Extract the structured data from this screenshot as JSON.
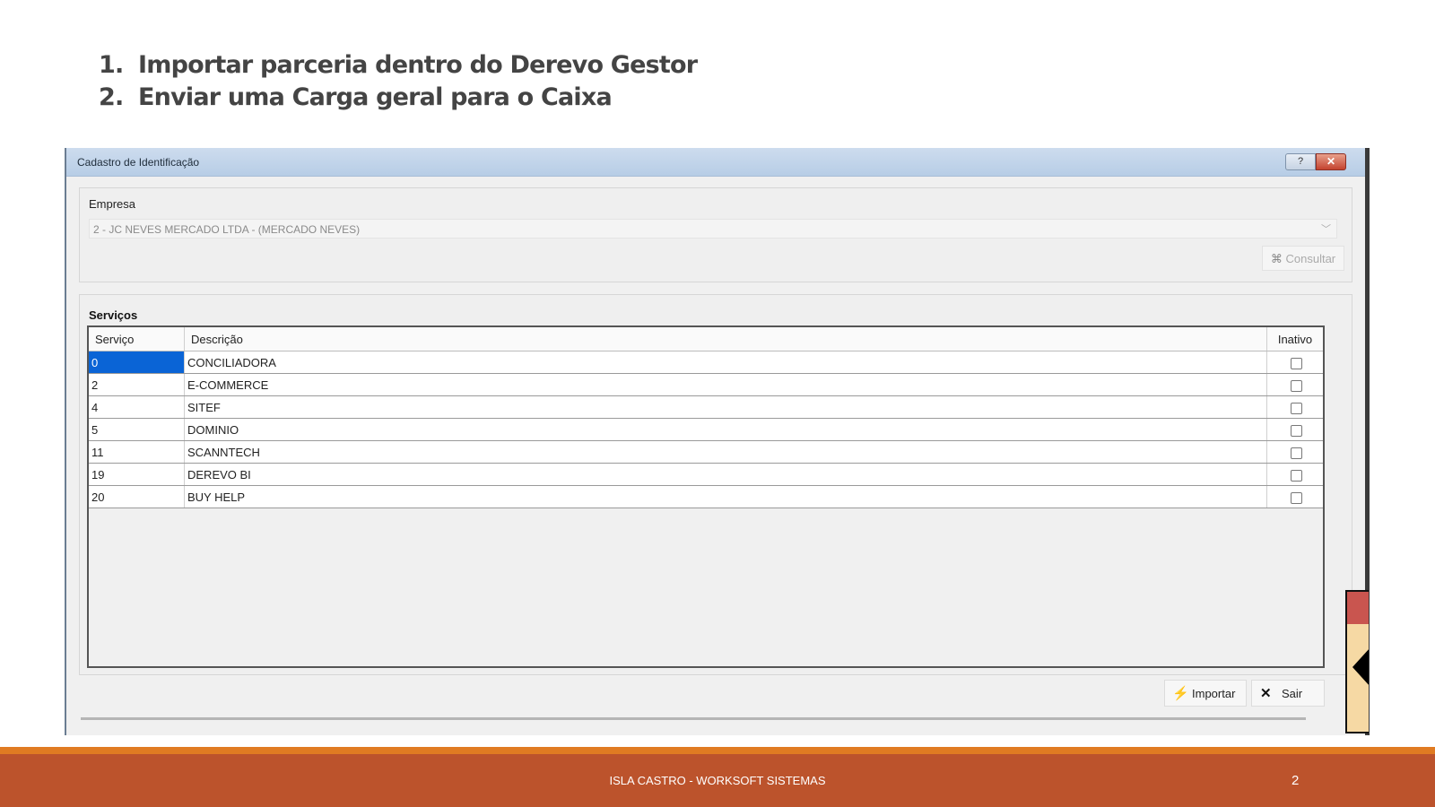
{
  "slide": {
    "steps": [
      {
        "num": "1.",
        "text": "Importar parceria dentro do Derevo Gestor"
      },
      {
        "num": "2.",
        "text": "Enviar uma Carga geral para o Caixa"
      }
    ],
    "footer_text": "ISLA CASTRO - WORKSOFT SISTEMAS",
    "page_number": "2"
  },
  "window": {
    "title": "Cadastro de Identificação",
    "help_glyph": "?",
    "close_glyph": "✕",
    "empresa_label": "Empresa",
    "empresa_value": "2 - JC NEVES MERCADO LTDA - (MERCADO NEVES)",
    "consultar_label": "Consultar",
    "servicos_title": "Serviços",
    "columns": [
      "Serviço",
      "Descrição",
      "Inativo"
    ],
    "rows": [
      {
        "servico": "0",
        "descricao": "CONCILIADORA",
        "inativo": false
      },
      {
        "servico": "2",
        "descricao": "E-COMMERCE",
        "inativo": false
      },
      {
        "servico": "4",
        "descricao": "SITEF",
        "inativo": false
      },
      {
        "servico": "5",
        "descricao": "DOMINIO",
        "inativo": false
      },
      {
        "servico": "11",
        "descricao": "SCANNTECH",
        "inativo": false
      },
      {
        "servico": "19",
        "descricao": "DEREVO BI",
        "inativo": false
      },
      {
        "servico": "20",
        "descricao": "BUY HELP",
        "inativo": false
      }
    ],
    "importar_label": "Importar",
    "sair_label": "Sair"
  },
  "icons": {
    "consultar": "binoculars-icon",
    "importar": "lightning-icon",
    "sair": "close-x-icon",
    "combo": "chevron-down-icon"
  },
  "colors": {
    "footer_bg": "#bc532c",
    "footer_line": "#e07b22",
    "selection": "#0a64d6"
  }
}
